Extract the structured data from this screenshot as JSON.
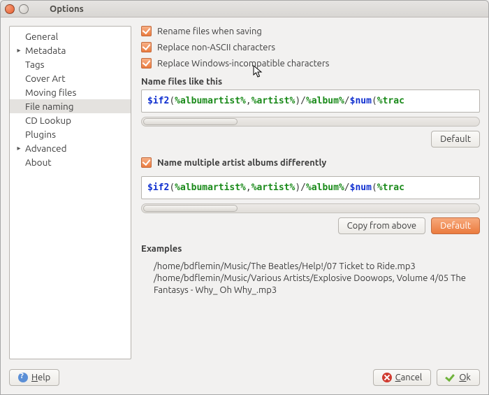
{
  "window": {
    "title": "Options"
  },
  "sidebar": {
    "items": [
      {
        "label": "General",
        "expandable": false
      },
      {
        "label": "Metadata",
        "expandable": true
      },
      {
        "label": "Tags",
        "expandable": false
      },
      {
        "label": "Cover Art",
        "expandable": false
      },
      {
        "label": "Moving files",
        "expandable": false
      },
      {
        "label": "File naming",
        "expandable": false,
        "selected": true
      },
      {
        "label": "CD Lookup",
        "expandable": false
      },
      {
        "label": "Plugins",
        "expandable": false
      },
      {
        "label": "Advanced",
        "expandable": true
      },
      {
        "label": "About",
        "expandable": false
      }
    ]
  },
  "options": {
    "rename_files": {
      "checked": true,
      "label": "Rename files when saving"
    },
    "replace_ascii": {
      "checked": true,
      "label": "Replace non-ASCII characters"
    },
    "replace_win": {
      "checked": true,
      "label": "Replace Windows-incompatible characters"
    }
  },
  "naming": {
    "heading": "Name files like this",
    "default_btn": "Default"
  },
  "multi": {
    "checked": true,
    "label": "Name multiple artist albums differently",
    "copy_btn": "Copy from above",
    "default_btn": "Default"
  },
  "formula": {
    "fn_if2": "$if2",
    "open": "(",
    "close": ")",
    "slash": "/",
    "comma": ",",
    "var_albumartist": "%albumartist%",
    "var_artist": "%artist%",
    "var_album": "%album%",
    "fn_num": "$num",
    "var_track_trunc": "%trac"
  },
  "examples": {
    "heading": "Examples",
    "line1": "/home/bdflemin/Music/The Beatles/Help!/07 Ticket to Ride.mp3",
    "line2": "/home/bdflemin/Music/Various Artists/Explosive Doowops, Volume 4/05 The Fantasys - Why_ Oh Why_.mp3"
  },
  "footer": {
    "help": "Help",
    "cancel": "Cancel",
    "ok": "Ok"
  }
}
